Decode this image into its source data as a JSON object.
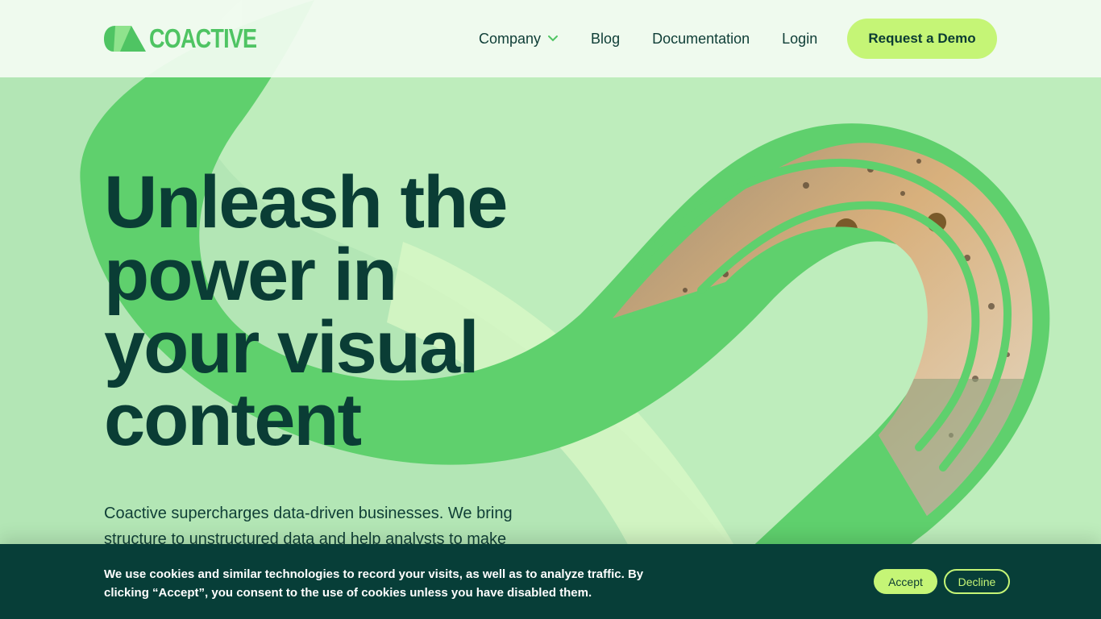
{
  "brand": {
    "name": "COACTIVE",
    "colors": {
      "accent": "#c5f576",
      "brand_green": "#4fc463",
      "dark": "#073e38",
      "hero_bg": "#b3e6b5"
    }
  },
  "nav": {
    "items": [
      {
        "label": "Company",
        "icon": "chevron-down-icon"
      },
      {
        "label": "Blog"
      },
      {
        "label": "Documentation"
      },
      {
        "label": "Login"
      }
    ],
    "cta_label": "Request a Demo"
  },
  "hero": {
    "title_lines": [
      "Unleash the",
      "power in",
      "your visual",
      "content"
    ],
    "subtitle": "Coactive supercharges data-driven businesses. We bring structure to unstructured data and help analysts to make",
    "image": "cheetah-photo"
  },
  "cookie": {
    "text": "We use cookies and similar technologies to record your visits, as well as to analyze traffic. By clicking “Accept”, you consent to the use of cookies unless you have disabled them.",
    "accept_label": "Accept",
    "decline_label": "Decline"
  }
}
